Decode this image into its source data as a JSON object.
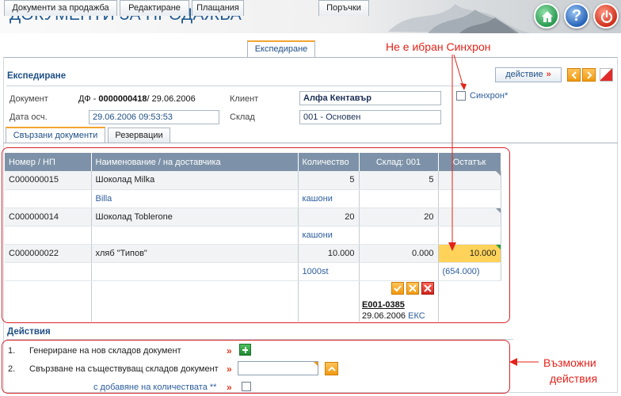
{
  "header": {
    "title": "ДОКУМЕНТИ ЗА ПРОДАЖБА"
  },
  "tabs": [
    {
      "label": "Документи за продажба",
      "active": false
    },
    {
      "label": "Редактиране",
      "active": false
    },
    {
      "label": "Плащания",
      "active": false
    },
    {
      "label": "Експедиране",
      "active": true
    },
    {
      "label": "Поръчки",
      "active": false
    }
  ],
  "section": {
    "title": "Експедиране",
    "action_label": "действие",
    "action_arrow": "»",
    "sync_label": "Синхрон*",
    "sync_checked": false
  },
  "form": {
    "document_label": "Документ",
    "document_prefix": "ДФ - ",
    "document_number": "0000000418",
    "document_date": "/ 29.06.2006",
    "client_label": "Клиент",
    "client_value": "Алфа Кентавър",
    "date_label": "Дата осч.",
    "date_value": "29.06.2006 09:53:53",
    "warehouse_label": "Склад",
    "warehouse_value": "001 - Основен"
  },
  "subtabs": [
    {
      "label": "Свързани документи",
      "active": true
    },
    {
      "label": "Резервации",
      "active": false
    }
  ],
  "table": {
    "headers": [
      "Номер / НП",
      "Наименование / на доставчика",
      "Количество",
      "Склад: 001",
      "Остатък"
    ],
    "rows": [
      {
        "number": "C000000015",
        "name": "Шоколад Milka",
        "qty": "5",
        "stock": "5",
        "rest": "",
        "sub_name": "Billa",
        "sub_unit": "кашони",
        "sub_rest": ""
      },
      {
        "number": "C000000014",
        "name": "Шоколад Toblerone",
        "qty": "20",
        "stock": "20",
        "rest": "",
        "sub_name": "",
        "sub_unit": "кашони",
        "sub_rest": ""
      },
      {
        "number": "C000000022",
        "name": "хляб \"Типов\"",
        "qty": "10.000",
        "stock": "0.000",
        "rest": "10.000",
        "sub_name": "",
        "sub_unit": "1000st",
        "sub_rest": "(654.000)"
      }
    ],
    "doc_ref": "E001-0385",
    "doc_date": "29.06.2006",
    "doc_type": "ЕКС"
  },
  "actions": {
    "title": "Действия",
    "items": [
      {
        "num": "1.",
        "label": "Генериране на нов складов документ"
      },
      {
        "num": "2.",
        "label": "Свързване на съществуващ складов документ"
      }
    ],
    "with_qty_label": "с добавяне на количествата **",
    "raquo": "»"
  },
  "annotations": {
    "sync_note": "Не е ибран Синхрон",
    "actions_note_1": "Възможни",
    "actions_note_2": "действия",
    "color": "#e2231a"
  }
}
